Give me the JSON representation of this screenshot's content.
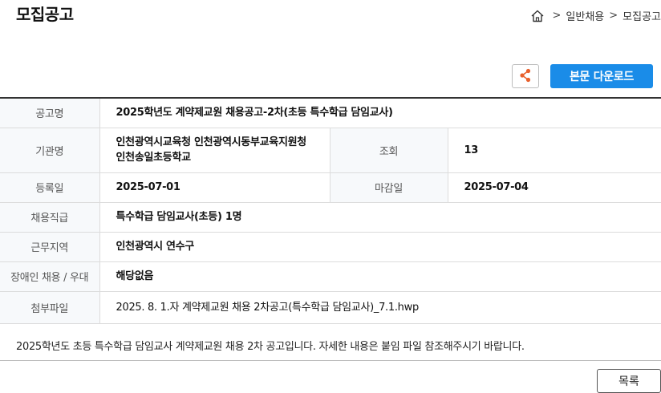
{
  "page": {
    "title": "모집공고"
  },
  "breadcrumb": {
    "items": [
      "일반채용",
      "모집공고"
    ],
    "separator": ">"
  },
  "toolbar": {
    "download_label": "본문 다운로드"
  },
  "colors": {
    "accent": "#1a8ce8",
    "share_icon": "#e8602c"
  },
  "info": {
    "title_label": "공고명",
    "title_value": "2025학년도 계약제교원 채용공고-2차(초등 특수학급 담임교사)",
    "org_label": "기관명",
    "org_value": "인천광역시교육청 인천광역시동부교육지원청 인천송일초등학교",
    "views_label": "조회",
    "views_value": "13",
    "reg_label": "등록일",
    "reg_value": "2025-07-01",
    "deadline_label": "마감일",
    "deadline_value": "2025-07-04",
    "job_label": "채용직급",
    "job_value": "특수학급 담임교사(초등) 1명",
    "region_label": "근무지역",
    "region_value": "인천광역시 연수구",
    "disabled_label": "장애인 채용 / 우대",
    "disabled_value": "해당없음",
    "attach_label": "첨부파일",
    "attach_value": "2025. 8. 1.자 계약제교원 채용 2차공고(특수학급 담임교사)_7.1.hwp"
  },
  "description": "2025학년도 초등 특수학급 담임교사 계약제교원 채용 2차 공고입니다. 자세한 내용은 붙임 파일 참조해주시기 바랍니다.",
  "footer": {
    "list_label": "목록"
  }
}
